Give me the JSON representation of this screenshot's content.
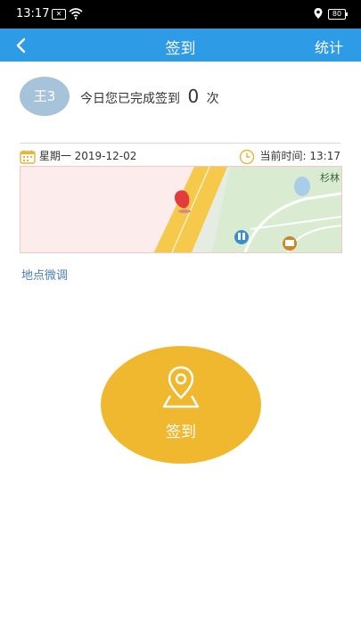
{
  "status_bar": {
    "time": "13:17",
    "battery": "80"
  },
  "header": {
    "title": "签到",
    "stats": "统计"
  },
  "user": {
    "avatar_text": "王3"
  },
  "checkin_summary": {
    "prefix": "今日您已完成签到",
    "count": "0",
    "suffix": "次"
  },
  "info": {
    "date": "星期一 2019-12-02",
    "time": "当前时间: 13:17"
  },
  "map": {
    "place_label": "杉林"
  },
  "adjust_link": "地点微调",
  "checkin_button": "签到",
  "colors": {
    "primary": "#2e9be6",
    "accent": "#f0b82e",
    "link": "#4a7fb7"
  }
}
